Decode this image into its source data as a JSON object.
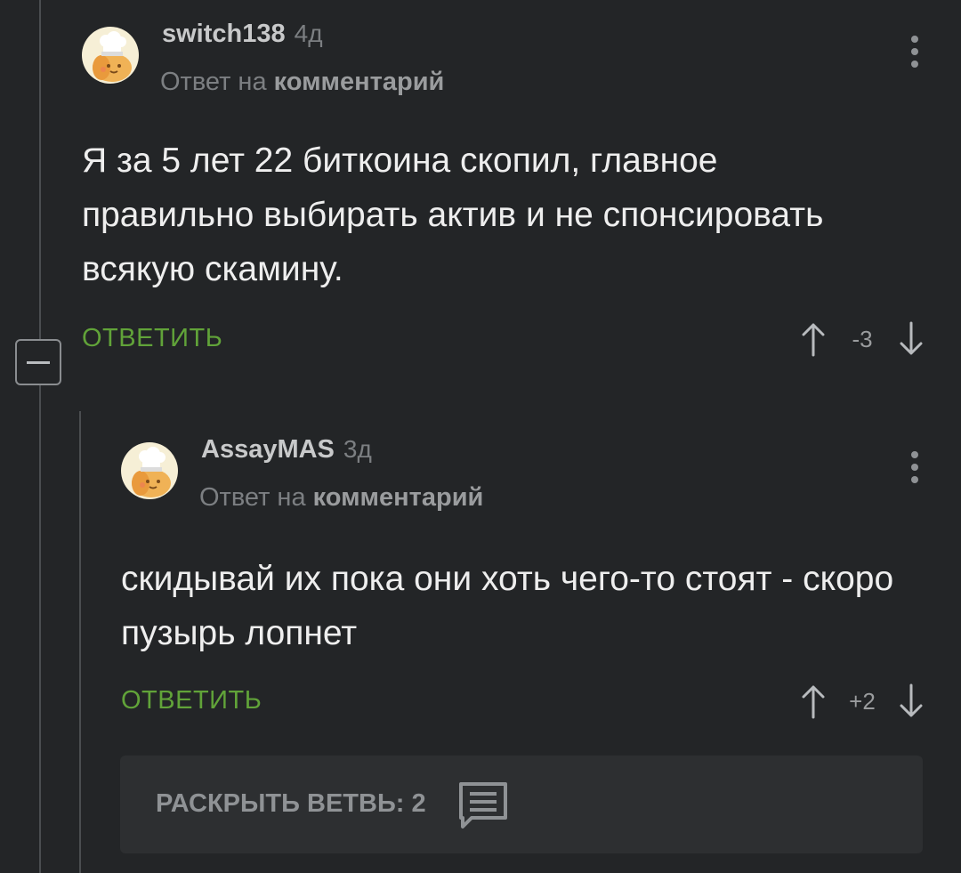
{
  "comments": [
    {
      "username": "switch138",
      "age": "4д",
      "reply_to_prefix": "Ответ на",
      "reply_to_target": "комментарий",
      "text": "Я за 5 лет 22 биткоина скопил, главное правильно выбирать актив и не спонсировать всякую скамину.",
      "reply_label": "ОТВЕТИТЬ",
      "rating": "-3"
    },
    {
      "username": "AssayMAS",
      "age": "3д",
      "reply_to_prefix": "Ответ на",
      "reply_to_target": "комментарий",
      "text": "скидывай их пока они хоть чего-то стоят - скоро пузырь лопнет",
      "reply_label": "ОТВЕТИТЬ",
      "rating": "+2"
    }
  ],
  "expand_branch": {
    "label": "РАСКРЫТЬ ВЕТВЬ: 2",
    "icon": "comment-icon"
  },
  "icons": {
    "upvote": "arrow-up-icon",
    "downvote": "arrow-down-icon",
    "more": "more-vertical-icon",
    "collapse": "minus-icon"
  },
  "colors": {
    "background": "#232527",
    "accent_green": "#61a339",
    "panel": "#2d2f31"
  }
}
